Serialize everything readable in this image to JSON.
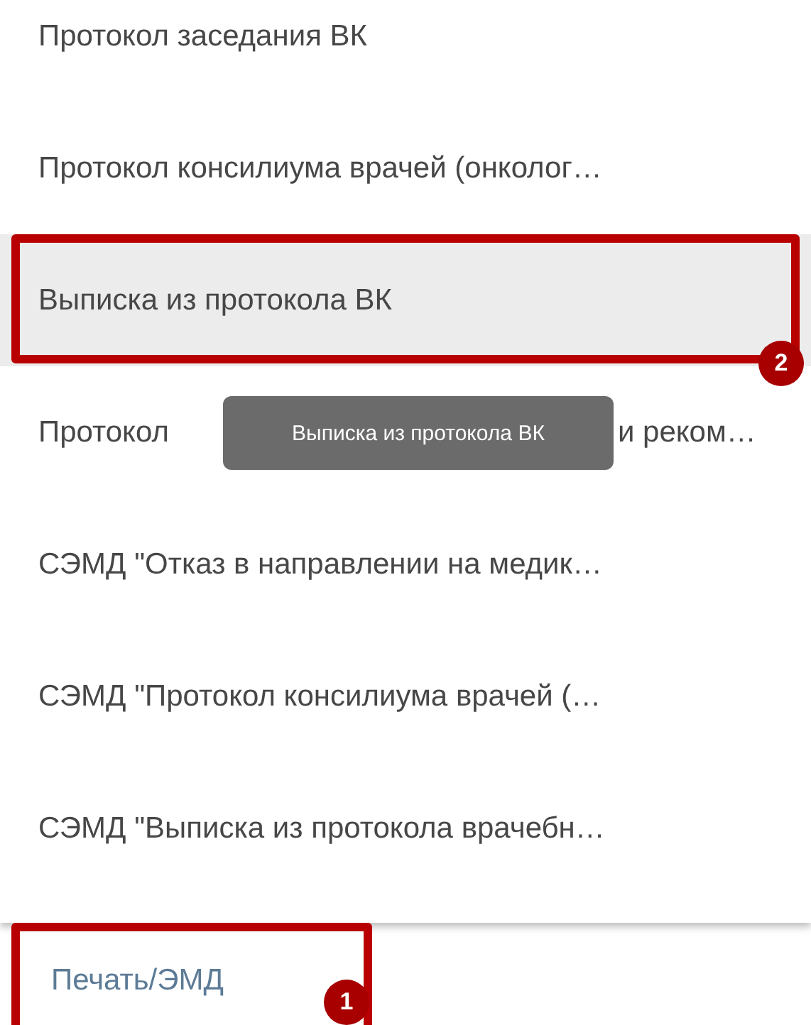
{
  "menu": {
    "items": [
      {
        "kind": "plain",
        "text": "Протокол заседания ВК",
        "selected": false
      },
      {
        "kind": "plain",
        "text": "Протокол консилиума врачей (онколог…",
        "selected": false
      },
      {
        "kind": "plain",
        "text": "Выписка из протокола ВК",
        "selected": true,
        "callout": "2"
      },
      {
        "kind": "covered",
        "text_start": "Протокол",
        "text_end": "и реком…",
        "selected": false,
        "tooltip": "Выписка из протокола ВК"
      },
      {
        "kind": "plain",
        "text": "СЭМД \"Отказ в направлении на медик…",
        "selected": false
      },
      {
        "kind": "plain",
        "text": "СЭМД \"Протокол консилиума врачей (…",
        "selected": false
      },
      {
        "kind": "plain",
        "text": "СЭМД \"Выписка из протокола врачебн…",
        "selected": false
      }
    ]
  },
  "print_button": {
    "label": "Печать/ЭМД",
    "callout": "1"
  }
}
